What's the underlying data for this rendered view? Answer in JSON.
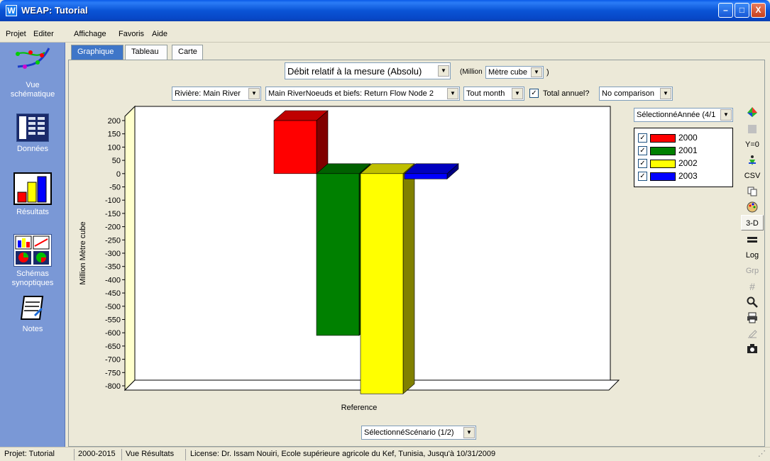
{
  "window": {
    "title": "WEAP: Tutorial",
    "app_icon": "W",
    "minimize": "–",
    "maximize": "□",
    "close": "X"
  },
  "menu": [
    "Projet",
    "Editer",
    "Affichage",
    "Favoris",
    "Aide"
  ],
  "nav": {
    "items": [
      {
        "label1": "Vue",
        "label2": "schématique",
        "icon": "schematic-icon"
      },
      {
        "label1": "Données",
        "label2": "",
        "icon": "data-table-icon"
      },
      {
        "label1": "Résultats",
        "label2": "",
        "icon": "results-bar-chart-icon"
      },
      {
        "label1": "Schémas",
        "label2": "synoptiques",
        "icon": "overviews-icon"
      },
      {
        "label1": "Notes",
        "label2": "",
        "icon": "notes-icon"
      }
    ],
    "selected": "Résultats"
  },
  "tabs": [
    "Graphique",
    "Tableau",
    "Carte"
  ],
  "controls": {
    "variable": "Débit relatif à la mesure (Absolu)",
    "unit_prefix": "(Million",
    "unit": "Mètre cube",
    "unit_suffix": ")",
    "river": "Rivière: Main River",
    "node": "Main RiverNoeuds et biefs: Return Flow Node 2",
    "month": "Tout month",
    "annual_total_label": "Total annuel?",
    "annual_total_checked": "✓",
    "comparison": "No comparison",
    "year_selector": "SélectionnéAnnée (4/1",
    "scenario_selector": "SélectionnéScénario (1/2)"
  },
  "legend": [
    {
      "label": "2000",
      "color": "#ff0000",
      "check": "✓"
    },
    {
      "label": "2001",
      "color": "#008000",
      "check": "✓"
    },
    {
      "label": "2002",
      "color": "#ffff00",
      "check": "✓"
    },
    {
      "label": "2003",
      "color": "#0000ff",
      "check": "✓"
    }
  ],
  "chart_data": {
    "type": "bar",
    "categories": [
      "Reference"
    ],
    "series": [
      {
        "name": "2000",
        "values": [
          200
        ],
        "color": "#ff0000"
      },
      {
        "name": "2001",
        "values": [
          -610
        ],
        "color": "#008000"
      },
      {
        "name": "2002",
        "values": [
          -830
        ],
        "color": "#ffff00"
      },
      {
        "name": "2003",
        "values": [
          -20
        ],
        "color": "#0000ff"
      }
    ],
    "ylabel": "Million Mètre cube",
    "xlabel": "",
    "ylim": [
      -800,
      200
    ],
    "yticks": [
      200,
      150,
      100,
      50,
      0,
      -50,
      -100,
      -150,
      -200,
      -250,
      -300,
      -350,
      -400,
      -450,
      -500,
      -550,
      -600,
      -650,
      -700,
      -750,
      -800
    ],
    "style": "3d",
    "grid": false
  },
  "toolbar": [
    {
      "label": "",
      "icon": "chart-colors-icon"
    },
    {
      "label": "",
      "icon": "gray-square-icon"
    },
    {
      "label": "Y=0"
    },
    {
      "label": "",
      "icon": "stack-person-icon"
    },
    {
      "label": "CSV"
    },
    {
      "label": "",
      "icon": "copy-icon"
    },
    {
      "label": "",
      "icon": "palette-icon"
    },
    {
      "label": "3-D"
    },
    {
      "label": "",
      "icon": "line-icon"
    },
    {
      "label": "Log"
    },
    {
      "label": "Grp"
    },
    {
      "label": "#",
      "icon": "grid-icon"
    },
    {
      "label": "",
      "icon": "zoom-icon"
    },
    {
      "label": "",
      "icon": "print-icon"
    },
    {
      "label": "",
      "icon": "hand-edit-icon"
    },
    {
      "label": "",
      "icon": "camera-icon"
    }
  ],
  "status": {
    "project": "Projet: Tutorial",
    "years": "2000-2015",
    "view": "Vue Résultats",
    "license": "License: Dr. Issam Nouiri, Ecole supérieure agricole du Kef, Tunisia, Jusqu'à 10/31/2009"
  }
}
